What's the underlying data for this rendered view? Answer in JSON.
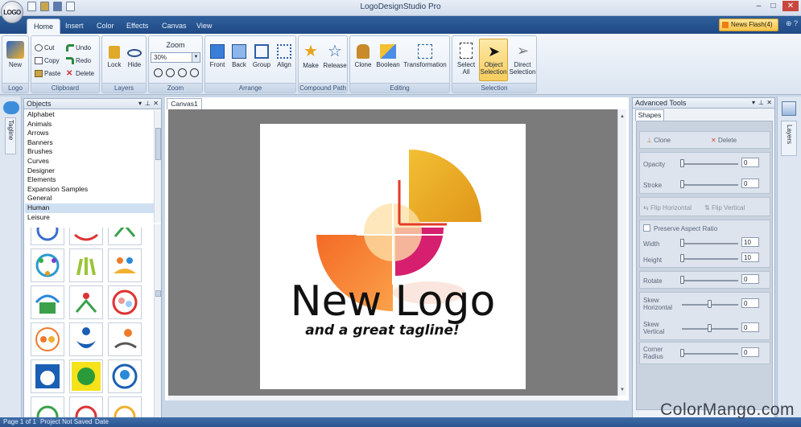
{
  "app": {
    "title": "LogoDesignStudio Pro",
    "orb_label": "LOGO"
  },
  "tabs": [
    "Home",
    "Insert",
    "Color",
    "Effects",
    "Canvas",
    "View"
  ],
  "newsflash": "News Flash(4)",
  "ribbon": {
    "logo": {
      "new": "New",
      "group": "Logo"
    },
    "clipboard": {
      "cut": "Cut",
      "copy": "Copy",
      "paste": "Paste",
      "undo": "Undo",
      "redo": "Redo",
      "delete": "Delete",
      "group": "Clipboard"
    },
    "layers": {
      "lock": "Lock",
      "hide": "Hide",
      "group": "Layers"
    },
    "zoom": {
      "title": "Zoom",
      "value": "30%",
      "group": "Zoom"
    },
    "arrange": {
      "front": "Front",
      "back": "Back",
      "group_btn": "Group",
      "align": "Align",
      "group": "Arrange"
    },
    "compound": {
      "make": "Make",
      "release": "Release",
      "group": "Compound Path"
    },
    "editing": {
      "clone": "Clone",
      "boolean": "Boolean",
      "transformation": "Transformation",
      "group": "Editing"
    },
    "selection": {
      "select_all_1": "Select",
      "select_all_2": "All",
      "object_sel_1": "Object",
      "object_sel_2": "Selection",
      "direct_sel_1": "Direct",
      "direct_sel_2": "Selection",
      "group": "Selection"
    }
  },
  "left_strip": {
    "tagline": "Tagline"
  },
  "objects": {
    "title": "Objects",
    "items": [
      "Alphabet",
      "Animals",
      "Arrows",
      "Banners",
      "Brushes",
      "Curves",
      "Designer",
      "Elements",
      "Expansion Samples",
      "General",
      "Human",
      "Leisure"
    ],
    "selected": "Human"
  },
  "canvas": {
    "tab": "Canvas1",
    "logo_text": "New Logo",
    "tagline": "and a great tagline!"
  },
  "advanced": {
    "title": "Advanced Tools",
    "tab": "Shapes",
    "clone": "Clone",
    "delete": "Delete",
    "opacity": {
      "label": "Opacity",
      "value": "0"
    },
    "stroke": {
      "label": "Stroke",
      "value": "0"
    },
    "flip_h": "Flip Horizontal",
    "flip_v": "Flip Vertical",
    "preserve": "Preserve Aspect Ratio",
    "width": {
      "label": "Width",
      "value": "10"
    },
    "height": {
      "label": "Height",
      "value": "10"
    },
    "rotate": {
      "label": "Rotate",
      "value": "0"
    },
    "skew_h": {
      "label1": "Skew",
      "label2": "Horizontal",
      "value": "0"
    },
    "skew_v": {
      "label1": "Skew",
      "label2": "Vertical",
      "value": "0"
    },
    "corner": {
      "label1": "Corner",
      "label2": "Radius",
      "value": "0"
    }
  },
  "layers_strip": {
    "label": "Layers"
  },
  "status": {
    "page": "Page 1 of 1",
    "project": "Project Not Saved",
    "date": "Date"
  },
  "watermark": "ColorMango.com",
  "colors": {
    "accent": "#2a5490",
    "selection": "#f7cd5d",
    "logo_orange": "#f07a2a",
    "logo_gold": "#e8a818",
    "logo_magenta": "#d61f6e",
    "logo_peach": "#fde0a8"
  }
}
